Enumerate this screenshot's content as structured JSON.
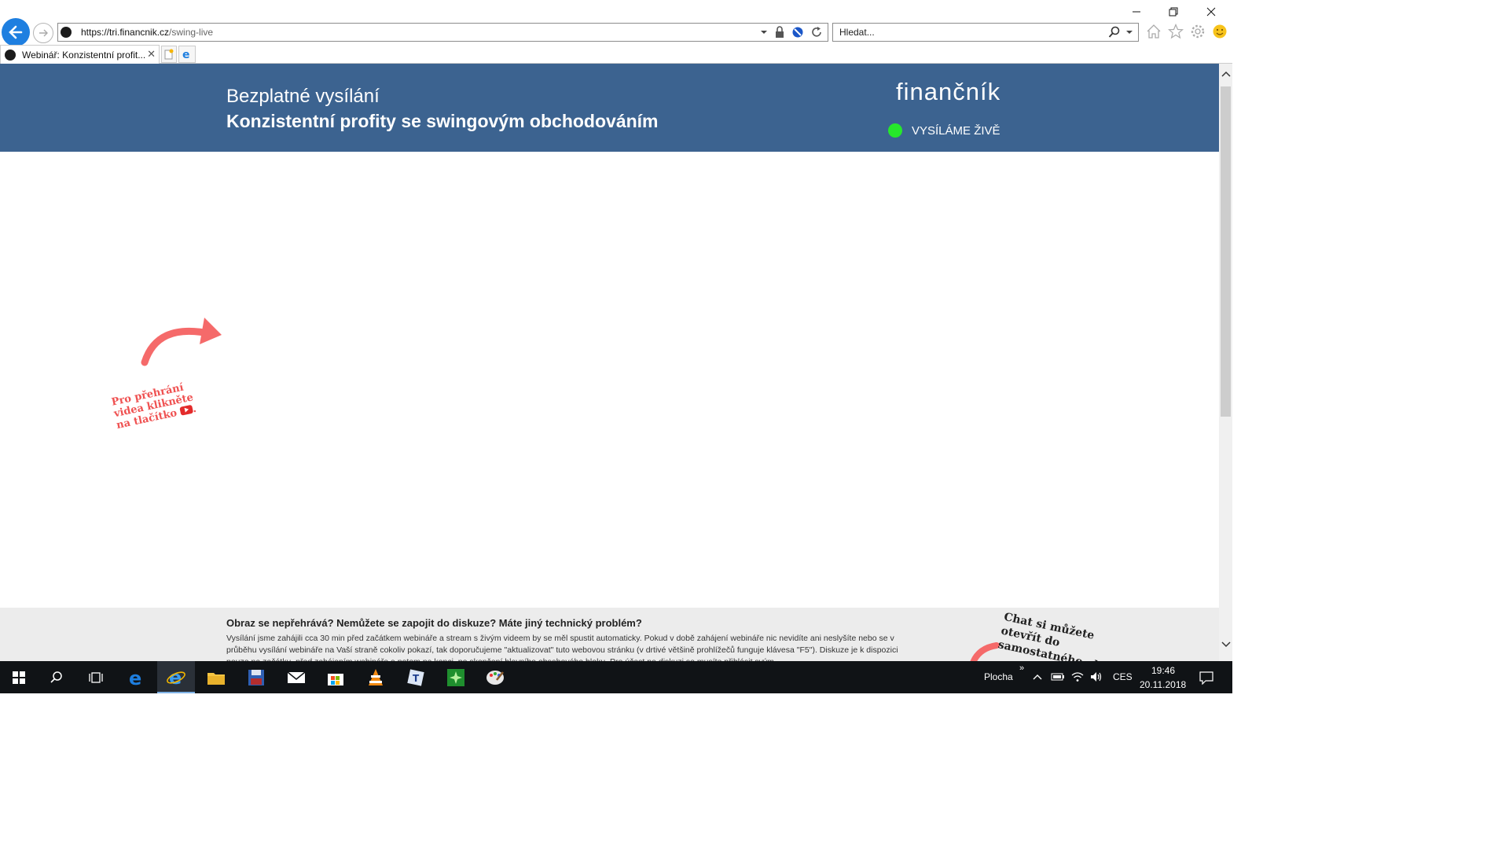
{
  "browser": {
    "url_host": "https://tri.financnik.cz",
    "url_path": "/swing-live",
    "search_placeholder": "Hledat...",
    "tab_title": "Webinář: Konzistentní profit..."
  },
  "header": {
    "subtitle": "Bezplatné vysílání",
    "title": "Konzistentní profity se swingovým obchodováním",
    "logo": "finančník",
    "live_label": "VYSÍLÁME ŽIVĚ",
    "live_color": "#26e82b",
    "bg_color": "#3c6390"
  },
  "video_hint": {
    "text": "Pro přehrání videa klikněte na tlačítko",
    "icon": "youtube-icon"
  },
  "help": {
    "title": "Obraz se nepřehrává? Nemůžete se zapojit do diskuze? Máte jiný technický problém?",
    "text": "Vysílání jsme zahájili cca 30 min před začátkem webináře a stream s živým videem by se měl spustit automaticky. Pokud v době zahájení webináře nic nevidíte ani neslyšíte nebo se v průběhu vysílání webináře na Vaší straně cokoliv pokazí, tak doporučujeme \"aktualizovat\" tuto webovou stránku (v drtivé většině prohlížečů funguje klávesa \"F5\"). Diskuze je k dispozici pouze na začátku, před zahájením webináře a potom na konci, po skončení hlavního obsahového bloku. Pro účast na diskuzi se musíte přihlásit svým",
    "chat_hint": "Chat si můžete otevřít do samostatného okna"
  },
  "taskbar": {
    "desktop_label": "Plocha",
    "lang": "CES",
    "time": "19:46",
    "date": "20.11.2018"
  }
}
